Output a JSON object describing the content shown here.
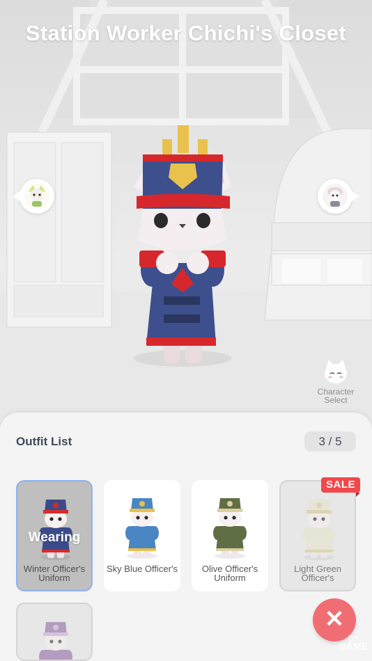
{
  "header": {
    "title": "Station Worker Chichi's Closet"
  },
  "character_nav": {
    "prev_icon": "character-portrait-icon",
    "next_icon": "character-portrait-icon"
  },
  "character_select": {
    "label": "Character Select",
    "icon": "cat-face-icon"
  },
  "outfit_panel": {
    "title": "Outfit List",
    "count": "3 / 5",
    "wearing_label": "Wearing",
    "sale_label": "SALE",
    "outfits": [
      {
        "name": "Winter Officer's Uniform",
        "coat": "#3d4a8a",
        "trim": "#d22c2c",
        "state": "wearing"
      },
      {
        "name": "Sky Blue Officer's",
        "coat": "#4a86c4",
        "trim": "#e7c14a",
        "state": "available"
      },
      {
        "name": "Olive Officer's Uniform",
        "coat": "#5f6e44",
        "trim": "#d9d0a2",
        "state": "available"
      },
      {
        "name": "Light Green Officer's",
        "coat": "#e7e3cf",
        "trim": "#d7c98c",
        "state": "sale"
      },
      {
        "name": "",
        "coat": "#8a5fa0",
        "trim": "#c9a8d8",
        "state": "locked"
      }
    ]
  },
  "close_button": {
    "label": "✕"
  },
  "watermark": {
    "top": "Your",
    "main": "GAME"
  },
  "colors": {
    "accent_blue": "#8fb1ee",
    "sale_red": "#f2474b",
    "close_red": "#f06e73"
  }
}
